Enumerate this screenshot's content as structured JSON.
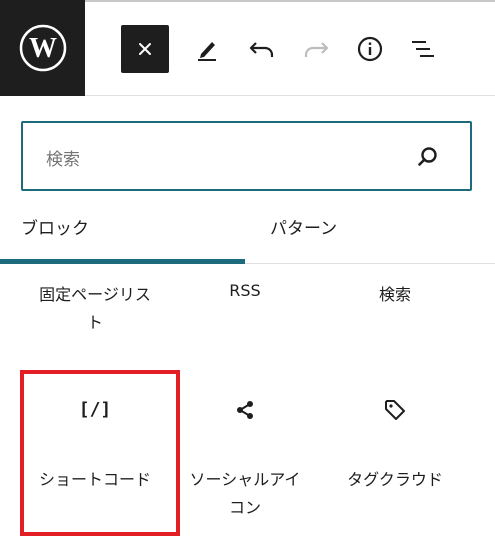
{
  "toolbar": {
    "logo": "wordpress-logo",
    "icons": [
      "close-icon",
      "pen-icon",
      "undo-icon",
      "redo-icon",
      "info-icon",
      "list-view-icon"
    ]
  },
  "search": {
    "placeholder": "検索"
  },
  "tabs": {
    "blocks": "ブロック",
    "patterns": "パターン"
  },
  "blocks": [
    {
      "label": "固定ページリスト"
    },
    {
      "label": "RSS"
    },
    {
      "label": "検索"
    },
    {
      "label": "ショートコード",
      "icon_text": "[/]"
    },
    {
      "label": "ソーシャルアイコン"
    },
    {
      "label": "タグクラウド"
    }
  ],
  "colors": {
    "accent": "#1b6b7c",
    "highlight": "#e31e24",
    "dark": "#1e1e1e"
  }
}
